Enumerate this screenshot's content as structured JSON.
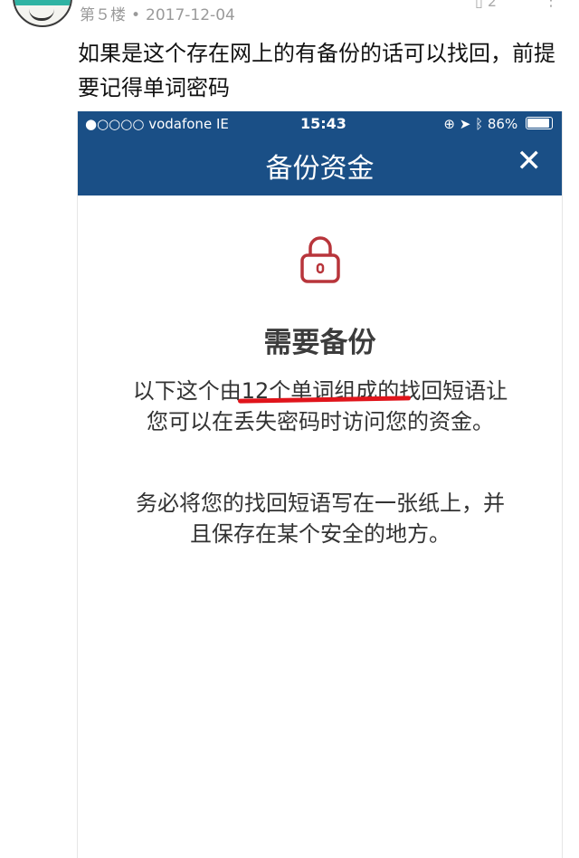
{
  "post": {
    "floor": "第５楼",
    "separator": "•",
    "date": "2017-12-04",
    "like_count": "2",
    "comment": "如果是这个存在网上的有备份的话可以找回，前提要记得单词密码"
  },
  "screenshot": {
    "status_bar": {
      "carrier": "●○○○○ vodafone IE",
      "time": "15:43",
      "battery": "86%"
    },
    "nav": {
      "title": "备份资金",
      "close_glyph": "✕"
    },
    "heading": "需要备份",
    "para1_before": "以下这个由",
    "para1_underlined": "12个单词组成的",
    "para1_after": "找回短语让您可以在丢失密码时访问您的资金。",
    "para2": "务必将您的找回短语写在一张纸上，并且保存在某个安全的地方。",
    "colors": {
      "header": "#1a4f86",
      "lock": "#b8353b",
      "underline": "#e0141b"
    }
  }
}
